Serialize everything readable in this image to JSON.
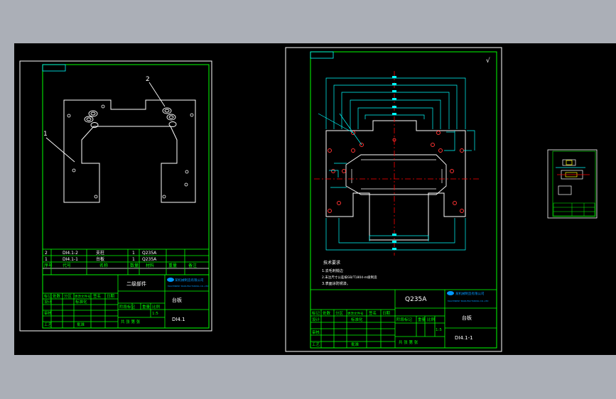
{
  "colors": {
    "viewport_bg": "#abafb7",
    "model_bg": "#000000",
    "frame": "#ffffff",
    "title_block": "#00ff00",
    "dims": "#00ffff",
    "center": "#ff0000",
    "logo": "#0099ff"
  },
  "left_sheet": {
    "leader_1": "1",
    "leader_2": "2",
    "parts_rows": [
      {
        "no": "2",
        "code": "DI4.1-2",
        "name": "支柱",
        "qty": "1",
        "material": "Q235A"
      },
      {
        "no": "1",
        "code": "DI4.1-1",
        "name": "台板",
        "qty": "1",
        "material": "Q235A"
      }
    ],
    "header": {
      "no": "序号",
      "code": "代号",
      "name": "名称",
      "qty": "数量",
      "material": "材料",
      "weight": "重量",
      "remark": "备注"
    },
    "assembly_title": "二级部件",
    "company": "某机械制造有限公司",
    "company_en": "MACHINERY MANUFACTURING CO.,LTD",
    "rev_labels": [
      "标记",
      "处数",
      "分区",
      "更改文件号",
      "签名",
      "日期"
    ],
    "role_labels": [
      "设计",
      "审核",
      "工艺"
    ],
    "std_label": "标准化",
    "approve_label": "批准",
    "stage_label": "阶段标记",
    "weight_label": "重量",
    "scale_label": "比例",
    "scale": "1:5",
    "sheet_label": "共 张 第 张",
    "drawing_name": "台板",
    "drawing_no": "DI4.1"
  },
  "right_sheet": {
    "roughness": "√",
    "notes_title": "技术要求",
    "notes": [
      "1.去毛刺锐边",
      "2.未注尺寸公差按GB/T1804-m级制造",
      "3.表面涂防锈漆。"
    ],
    "material": "Q235A",
    "company": "某机械制造有限公司",
    "company_en": "MACHINERY MANUFACTURING CO.,LTD",
    "drawing_name": "台板",
    "drawing_no": "DI4.1-1",
    "scale": "1:5",
    "rev_labels": [
      "标记",
      "处数",
      "分区",
      "更改文件号",
      "签名",
      "日期"
    ],
    "role_labels": [
      "设计",
      "审核",
      "工艺"
    ],
    "stage_label": "阶段标记",
    "weight_label": "重量",
    "scale_label": "比例",
    "sheet_label": "共 张 第 张",
    "std_label": "标准化",
    "approve_label": "批准"
  }
}
